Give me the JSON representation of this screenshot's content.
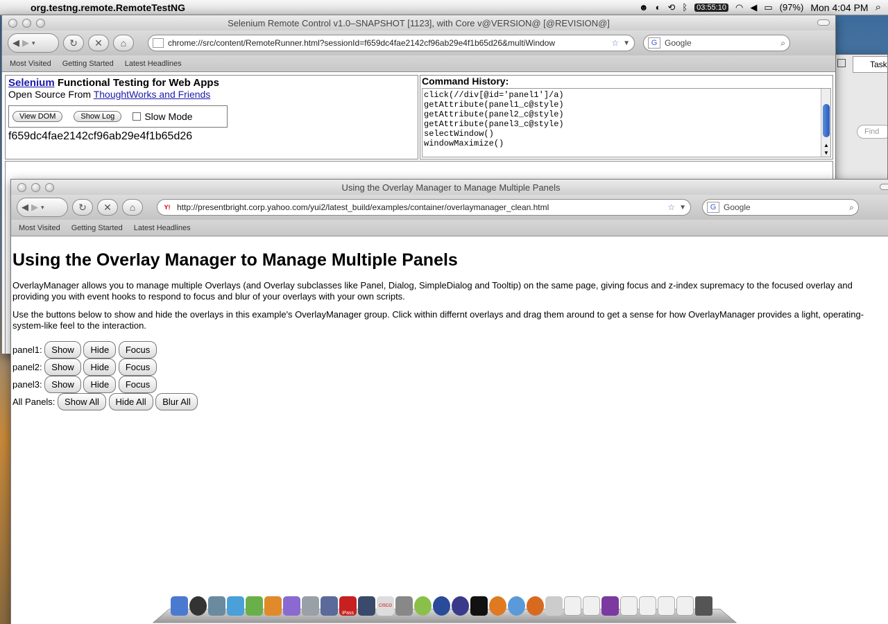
{
  "menubar": {
    "app_name": "org.testng.remote.RemoteTestNG",
    "clock": "03:55:10",
    "battery": "(97%)",
    "datetime": "Mon 4:04 PM"
  },
  "selenium_window": {
    "title": "Selenium Remote Control v1.0–SNAPSHOT [1123], with Core v@VERSION@ [@REVISION@]",
    "url": "chrome://src/content/RemoteRunner.html?sessionId=f659dc4fae2142cf96ab29e4f1b65d26&multiWindow",
    "search_placeholder": "Google",
    "bookmarks": [
      "Most Visited",
      "Getting Started",
      "Latest Headlines"
    ],
    "selenium_link": "Selenium",
    "heading_rest": "Functional Testing for Web Apps",
    "open_source_prefix": "Open Source From",
    "thoughtworks_link": "ThoughtWorks and Friends",
    "view_dom_label": "View DOM",
    "show_log_label": "Show Log",
    "slow_mode_label": "Slow Mode",
    "session_id": "f659dc4fae2142cf96ab29e4f1b65d26",
    "command_history_label": "Command History:",
    "commands": [
      "click(//div[@id='panel1']/a)",
      "getAttribute(panel1_c@style)",
      "getAttribute(panel2_c@style)",
      "getAttribute(panel3_c@style)",
      "selectWindow()",
      "windowMaximize()"
    ]
  },
  "yui_window": {
    "title": "Using the Overlay Manager to Manage Multiple Panels",
    "url": "http://presentbright.corp.yahoo.com/yui2/latest_build/examples/container/overlaymanager_clean.html",
    "search_placeholder": "Google",
    "bookmarks": [
      "Most Visited",
      "Getting Started",
      "Latest Headlines"
    ],
    "heading": "Using the Overlay Manager to Manage Multiple Panels",
    "paragraph1": "OverlayManager allows you to manage multiple Overlays (and Overlay subclasses like Panel, Dialog, SimpleDialog and Tooltip) on the same page, giving focus and z-index supremacy to the focused overlay and providing you with event hooks to respond to focus and blur of your overlays with your own scripts.",
    "paragraph2": "Use the buttons below to show and hide the overlays in this example's OverlayManager group. Click within differnt overlays and drag them around to get a sense for how OverlayManager provides a light, operating-system-like feel to the interaction.",
    "panel_rows": [
      {
        "label": "panel1:",
        "show": "Show",
        "hide": "Hide",
        "focus": "Focus"
      },
      {
        "label": "panel2:",
        "show": "Show",
        "hide": "Hide",
        "focus": "Focus"
      },
      {
        "label": "panel3:",
        "show": "Show",
        "hide": "Hide",
        "focus": "Focus"
      }
    ],
    "all_panels_label": "All Panels:",
    "show_all_label": "Show All",
    "hide_all_label": "Hide All",
    "blur_all_label": "Blur All"
  },
  "right_window": {
    "tab_label": "Task",
    "find_placeholder": "Find"
  },
  "dock": {
    "ipass_label": "iPass",
    "cisco_label": "CISCO"
  }
}
